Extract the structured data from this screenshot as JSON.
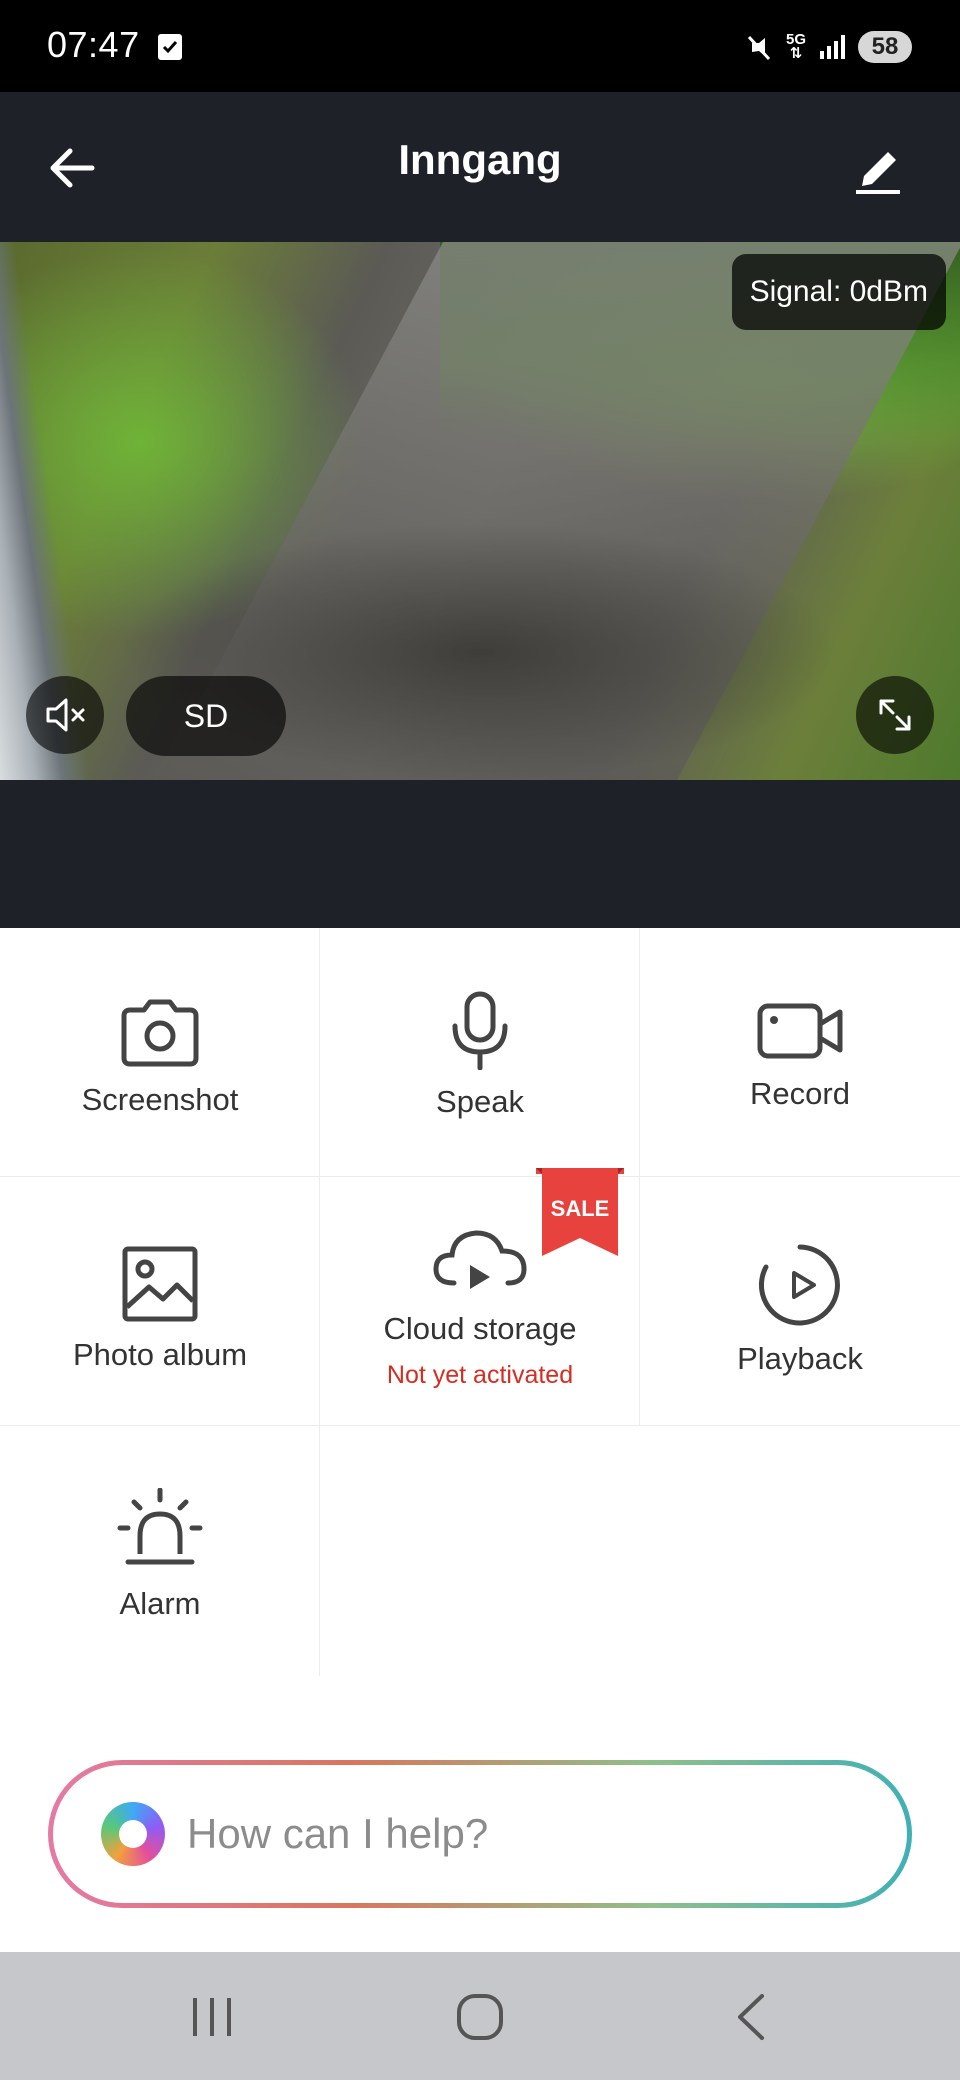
{
  "status_bar": {
    "time": "07:47",
    "network": "5G",
    "battery": "58"
  },
  "header": {
    "title": "Inngang"
  },
  "video": {
    "signal": "Signal: 0dBm",
    "quality": "SD"
  },
  "actions": {
    "screenshot": "Screenshot",
    "speak": "Speak",
    "record": "Record",
    "photo_album": "Photo album",
    "cloud_storage": "Cloud storage",
    "cloud_status": "Not yet activated",
    "sale_badge": "SALE",
    "playback": "Playback",
    "alarm": "Alarm"
  },
  "assistant": {
    "placeholder": "How can I help?"
  },
  "colors": {
    "header_bg": "#1e2128",
    "status_alert": "#d62c22",
    "sale_badge": "#e8423f"
  }
}
